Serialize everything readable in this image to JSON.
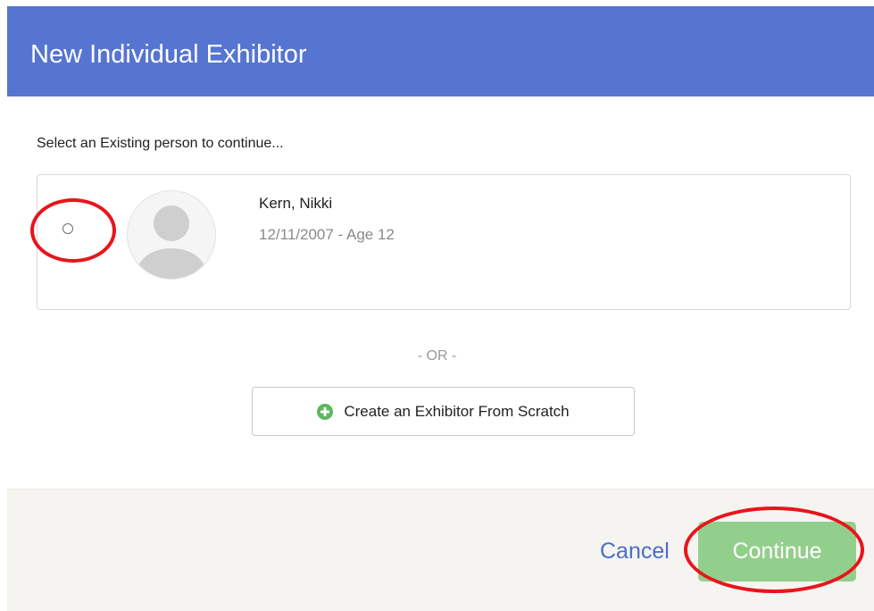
{
  "dialog": {
    "title": "New Individual Exhibitor",
    "prompt": "Select an Existing person to continue..."
  },
  "person": {
    "name": "Kern, Nikki",
    "meta": "12/11/2007 - Age 12",
    "selected": false,
    "avatar_icon": "user-placeholder-icon"
  },
  "divider": {
    "label": "- OR -"
  },
  "create_button": {
    "label": "Create an Exhibitor From Scratch",
    "icon": "plus-circle-icon"
  },
  "footer": {
    "cancel_label": "Cancel",
    "continue_label": "Continue"
  },
  "colors": {
    "header": "#5675d1",
    "continue": "#93cf8c",
    "link": "#4a6fc5",
    "success": "#5cb85c",
    "annotation": "#e8151b"
  }
}
